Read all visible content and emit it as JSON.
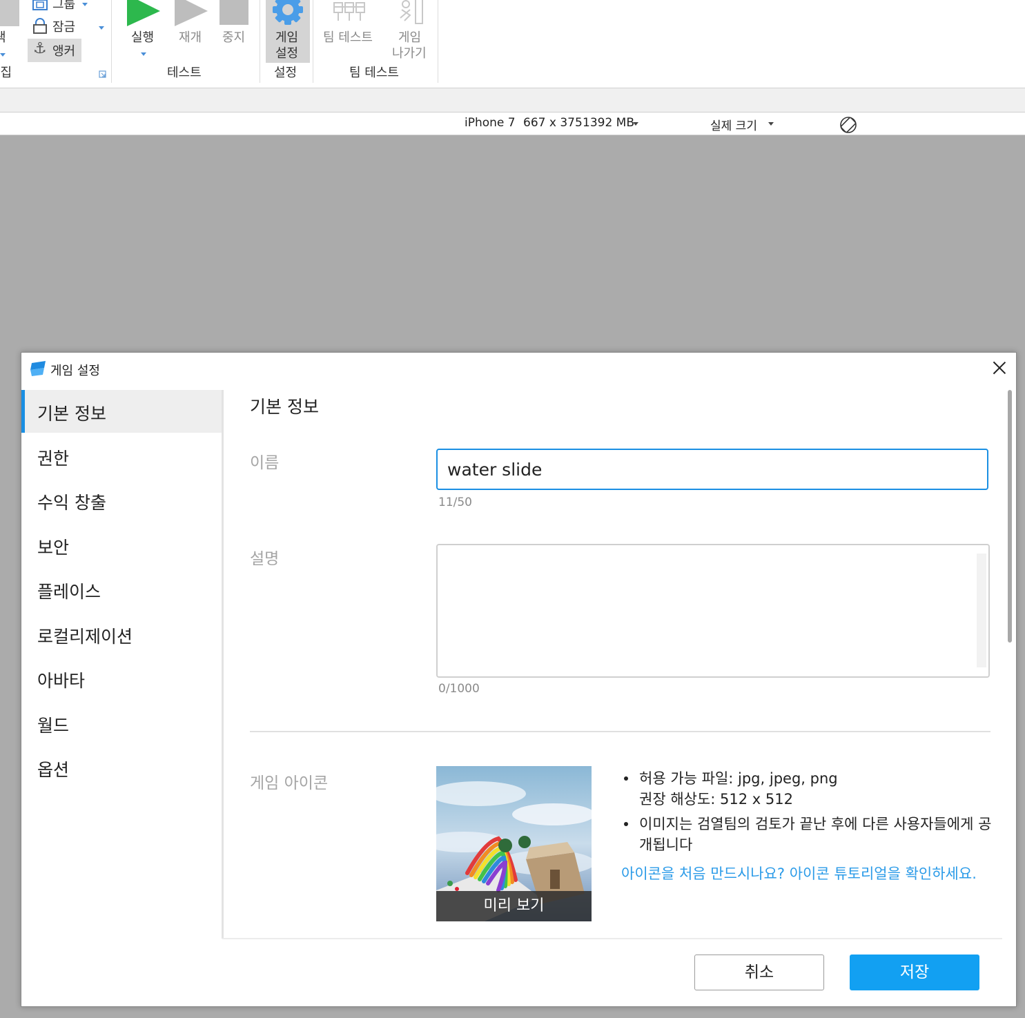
{
  "ribbon": {
    "edit_group": {
      "color_label": "색",
      "group_label": "그룹",
      "lock_label": "잠금",
      "anchor_label": "앵커",
      "group_title": "편집"
    },
    "test_group": {
      "run_label": "실행",
      "resume_label": "재개",
      "stop_label": "중지",
      "group_title": "테스트"
    },
    "settings_group": {
      "game_settings_line1": "게임",
      "game_settings_line2": "설정",
      "group_title": "설정"
    },
    "team_test_group": {
      "team_test_label": "팀 테스트",
      "exit_game_line1": "게임",
      "exit_game_line2": "나가기",
      "group_title": "팀 테스트"
    }
  },
  "device_bar": {
    "device": "iPhone 7",
    "resolution": "667 x 375",
    "memory": "1392 MB",
    "scale": "실제 크기"
  },
  "dialog": {
    "title": "게임 설정",
    "sidebar": {
      "items": [
        {
          "label": "기본 정보",
          "active": true
        },
        {
          "label": "권한"
        },
        {
          "label": "수익 창출"
        },
        {
          "label": "보안"
        },
        {
          "label": "플레이스"
        },
        {
          "label": "로컬리제이션"
        },
        {
          "label": "아바타"
        },
        {
          "label": "월드"
        },
        {
          "label": "옵션"
        }
      ]
    },
    "main": {
      "section_title": "기본 정보",
      "name_label": "이름",
      "name_value": "water slide",
      "name_counter": "11/50",
      "description_label": "설명",
      "description_value": "",
      "description_counter": "0/1000",
      "icon_label": "게임 아이콘",
      "preview_label": "미리 보기",
      "icon_bullets": [
        "허용 가능 파일: jpg, jpeg, png",
        "권장 해상도: 512 x 512",
        "이미지는 검열팀의 검토가 끝난 후에 다른 사용자들에게 공개됩니다"
      ],
      "tutorial_link": "아이콘을 처음 만드시나요? 아이콘 튜토리얼을 확인하세요."
    },
    "footer": {
      "cancel_label": "취소",
      "save_label": "저장"
    }
  },
  "colors": {
    "accent": "#1a8fe3",
    "save_button": "#12a0f2",
    "link": "#2b9be8",
    "run_green": "#2db84d",
    "viewport_bg": "#ababab"
  }
}
